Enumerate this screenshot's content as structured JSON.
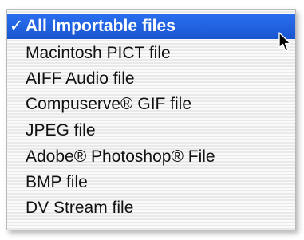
{
  "menu": {
    "check_glyph": "✓",
    "items": [
      {
        "label": "All Importable files",
        "selected": true
      },
      {
        "label": "Macintosh PICT file"
      },
      {
        "label": "AIFF Audio file"
      },
      {
        "label": "Compuserve® GIF file"
      },
      {
        "label": "JPEG file"
      },
      {
        "label": "Adobe® Photoshop® File"
      },
      {
        "label": "BMP file"
      },
      {
        "label": "DV Stream file"
      }
    ]
  },
  "colors": {
    "selection": "#1a57d6",
    "selected_text": "#ffffff",
    "text": "#111111"
  },
  "cursor": {
    "icon": "arrow-cursor-icon"
  }
}
